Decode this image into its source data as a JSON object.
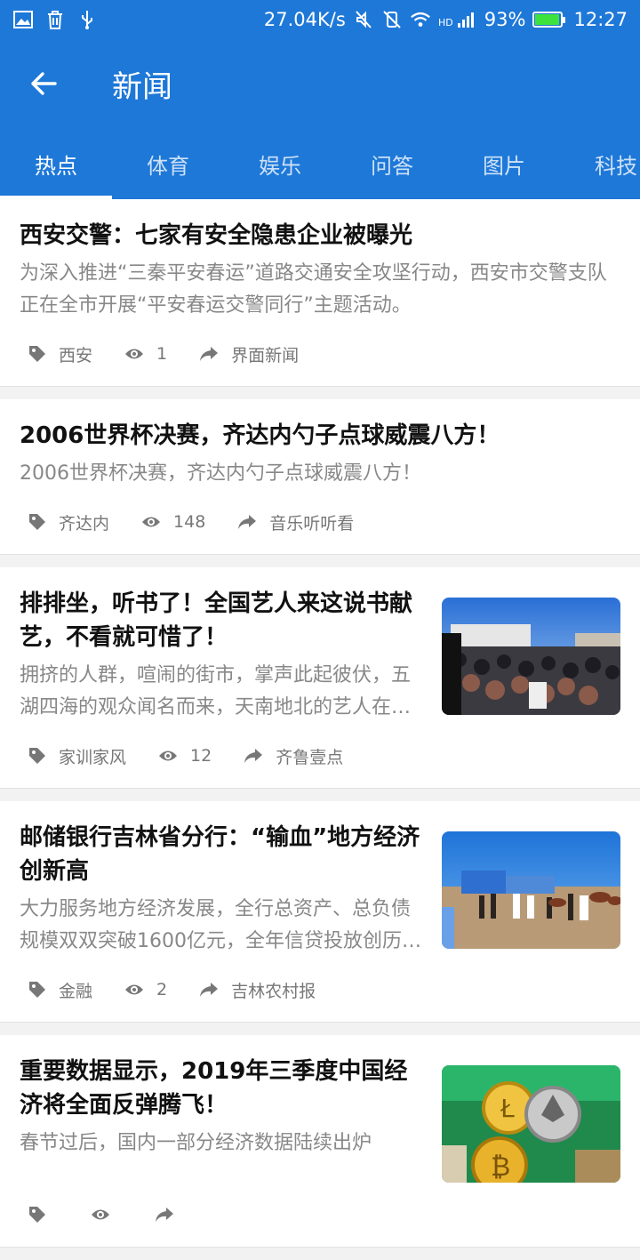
{
  "status": {
    "speed": "27.04K/s",
    "battery": "93%",
    "battery_level": 0.93,
    "time": "12:27"
  },
  "header": {
    "title": "新闻"
  },
  "tabs": [
    {
      "label": "热点",
      "active": true
    },
    {
      "label": "体育",
      "active": false
    },
    {
      "label": "娱乐",
      "active": false
    },
    {
      "label": "问答",
      "active": false
    },
    {
      "label": "图片",
      "active": false
    },
    {
      "label": "科技",
      "active": false
    }
  ],
  "news": [
    {
      "title": "西安交警：七家有安全隐患企业被曝光",
      "desc": "为深入推进“三秦平安春运”道路交通安全攻坚行动，西安市交警支队正在全市开展“平安春运交警同行”主题活动。",
      "tag": "西安",
      "views": "1",
      "source": "界面新闻"
    },
    {
      "title": "2006世界杯决赛，齐达内勺子点球威震八方！",
      "desc": "2006世界杯决赛，齐达内勺子点球威震八方！",
      "tag": "齐达内",
      "views": "148",
      "source": "音乐听听看"
    },
    {
      "title": "排排坐，听书了！全国艺人来这说书献艺，不看就可惜了！",
      "desc": "拥挤的人群，喧闹的街市，掌声此起彼伏，五湖四海的观众闻名而来，天南地北的艺人在此汇聚。",
      "tag": "家训家风",
      "views": "12",
      "source": "齐鲁壹点"
    },
    {
      "title": "邮储银行吉林省分行：“输血”地方经济创新高",
      "desc": "大力服务地方经济发展，全行总资产、总负债规模双双突破1600亿元，全年信贷投放创历史新高。",
      "tag": "金融",
      "views": "2",
      "source": "吉林农村报"
    },
    {
      "title": "重要数据显示，2019年三季度中国经济将全面反弹腾飞！",
      "desc": "春节过后，国内一部分经济数据陆续出炉",
      "tag": "",
      "views": "",
      "source": ""
    }
  ]
}
